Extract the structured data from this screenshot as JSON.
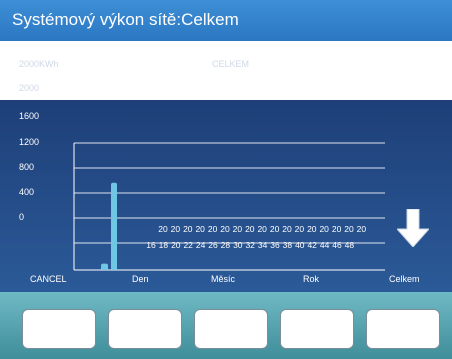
{
  "title": "Systémový výkon sítě:Celkem",
  "header": {
    "unit_tick": "2000KWh",
    "series_label": "CELKEM",
    "tick_2000": "2000"
  },
  "yticks": [
    "1600",
    "1200",
    "800",
    "400",
    "0"
  ],
  "nav": {
    "cancel": "CANCEL",
    "day": "Den",
    "month": "Měsíc",
    "year": "Rok",
    "total": "Celkem"
  },
  "colors": {
    "title_bar": "#2f7dc8",
    "panel_top": "#1e3f78",
    "bar": "#6fc7e3",
    "footer": "#5aa7b3"
  },
  "down_arrow_icon": "arrow-down",
  "chart_data": {
    "type": "bar",
    "categories": [
      "16",
      "18",
      "20",
      "22",
      "24",
      "26",
      "28",
      "30",
      "32",
      "34",
      "36",
      "38",
      "40",
      "42",
      "44",
      "46",
      "48"
    ],
    "category_prefix": "20",
    "values": [
      1100,
      80
    ],
    "ylim": [
      0,
      1600
    ],
    "title": "",
    "xlabel": "",
    "ylabel": ""
  }
}
